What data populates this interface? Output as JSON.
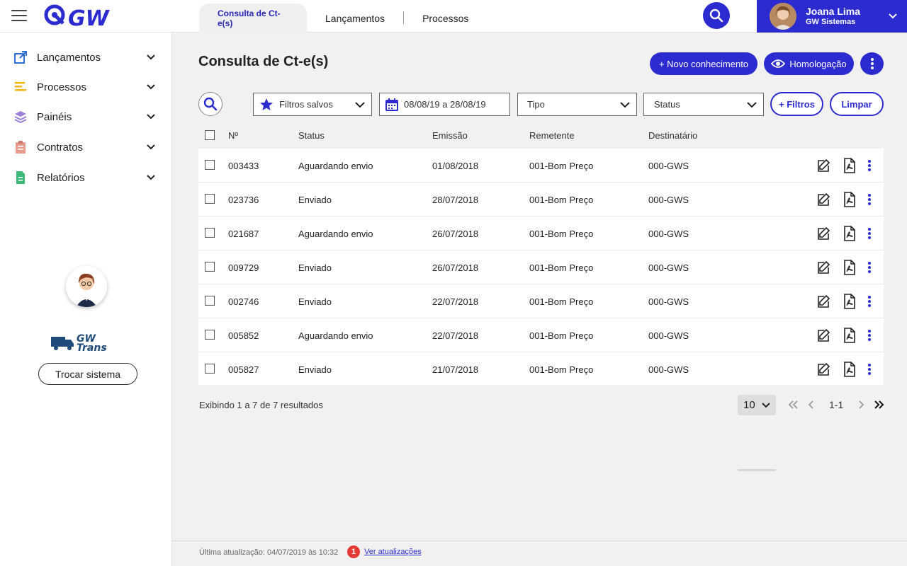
{
  "header": {
    "logo_text": "GW",
    "tabs": [
      {
        "label": "Consulta de Ct-e(s)",
        "active": true
      },
      {
        "label": "Lançamentos",
        "active": false
      },
      {
        "label": "Processos",
        "active": false
      }
    ],
    "user": {
      "name": "Joana Lima",
      "org": "GW Sistemas"
    },
    "accent_color": "#2b2bd0"
  },
  "sidebar": {
    "items": [
      {
        "label": "Lançamentos",
        "icon": "external-link-icon",
        "color": "#2d6fd6"
      },
      {
        "label": "Processos",
        "icon": "list-icon",
        "color": "#f2b400"
      },
      {
        "label": "Painéis",
        "icon": "layers-icon",
        "color": "#9b7fd8"
      },
      {
        "label": "Contratos",
        "icon": "clipboard-icon",
        "color": "#e89b8c"
      },
      {
        "label": "Relatórios",
        "icon": "document-icon",
        "color": "#3cb878"
      }
    ],
    "system_logo_text": "GW Trans",
    "switch_button": "Trocar sistema"
  },
  "main": {
    "title": "Consulta de Ct-e(s)",
    "new_button": "+ Novo conhecimento",
    "env_button": "Homologação",
    "filters": {
      "saved": "Filtros salvos",
      "date_range": "08/08/19 a 28/08/19",
      "type": "Tipo",
      "status": "Status",
      "more": "+ Filtros",
      "clear": "Limpar"
    },
    "table": {
      "columns": [
        "Nº",
        "Status",
        "Emissão",
        "Remetente",
        "Destinatário"
      ],
      "rows": [
        {
          "num": "003433",
          "status": "Aguardando envio",
          "date": "01/08/2018",
          "sender": "001-Bom Preço",
          "recipient": "000-GWS"
        },
        {
          "num": "023736",
          "status": "Enviado",
          "date": "28/07/2018",
          "sender": "001-Bom Preço",
          "recipient": "000-GWS"
        },
        {
          "num": "021687",
          "status": "Aguardando envio",
          "date": "26/07/2018",
          "sender": "001-Bom Preço",
          "recipient": "000-GWS"
        },
        {
          "num": "009729",
          "status": "Enviado",
          "date": "26/07/2018",
          "sender": "001-Bom Preço",
          "recipient": "000-GWS"
        },
        {
          "num": "002746",
          "status": "Enviado",
          "date": "22/07/2018",
          "sender": "001-Bom Preço",
          "recipient": "000-GWS"
        },
        {
          "num": "005852",
          "status": "Aguardando envio",
          "date": "22/07/2018",
          "sender": "001-Bom Preço",
          "recipient": "000-GWS"
        },
        {
          "num": "005827",
          "status": "Enviado",
          "date": "21/07/2018",
          "sender": "001-Bom Preço",
          "recipient": "000-GWS"
        }
      ]
    },
    "results_text": "Exibindo 1 a 7 de 7 resultados",
    "per_page": "10",
    "page_range": "1-1"
  },
  "footer": {
    "last_update": "Última atualização: 04/07/2019 às 10:32",
    "badge": "1",
    "link": "Ver atualizações"
  }
}
